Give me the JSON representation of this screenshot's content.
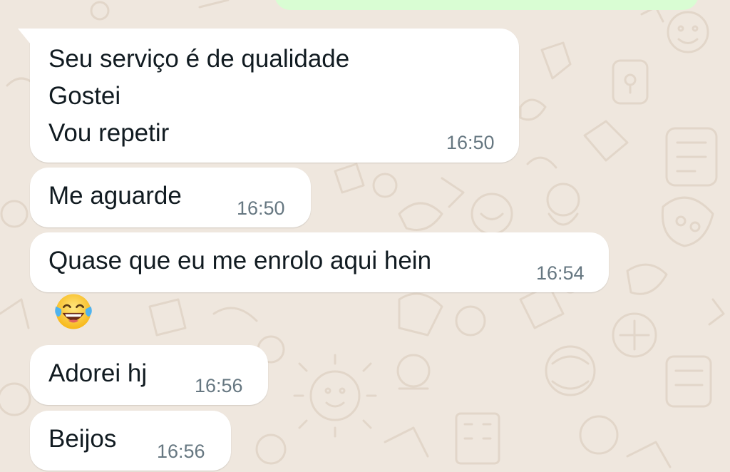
{
  "chat": {
    "messages": [
      {
        "text": "Seu serviço é de qualidade\nGostei\nVou repetir",
        "time": "16:50"
      },
      {
        "text": "Me aguarde",
        "time": "16:50"
      },
      {
        "text": "Quase que eu me enrolo aqui hein",
        "time": "16:54"
      },
      {
        "emoji": "😂",
        "emoji_name": "face-with-tears-of-joy-icon"
      },
      {
        "text": "Adorei hj",
        "time": "16:56"
      },
      {
        "text": "Beijos",
        "time": "16:56"
      }
    ]
  },
  "colors": {
    "wallpaper": "#efe7de",
    "incoming_bubble": "#ffffff",
    "outgoing_bubble": "#d9fdd3",
    "text": "#111b21",
    "timestamp": "#667781"
  }
}
